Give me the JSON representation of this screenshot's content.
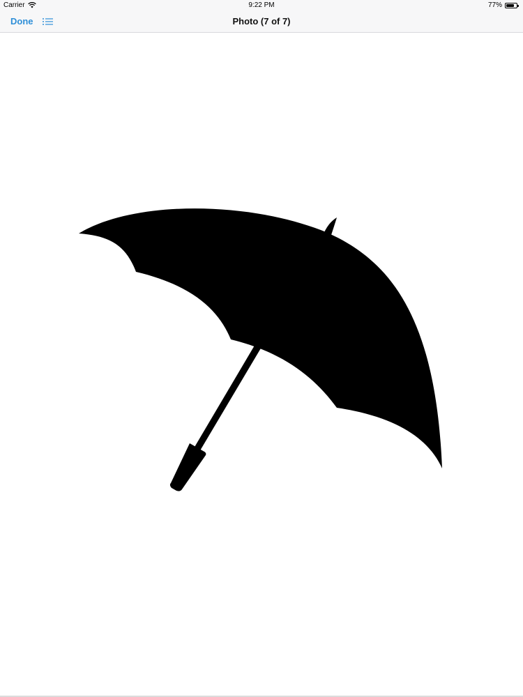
{
  "status_bar": {
    "carrier": "Carrier",
    "time": "9:22 PM",
    "battery_text": "77%",
    "battery_level": 0.77
  },
  "nav_bar": {
    "done_label": "Done",
    "title": "Photo (7 of 7)",
    "accent_color": "#2f8fd8",
    "list_icon": "list-icon"
  },
  "photo": {
    "subject_icon": "umbrella-icon"
  }
}
